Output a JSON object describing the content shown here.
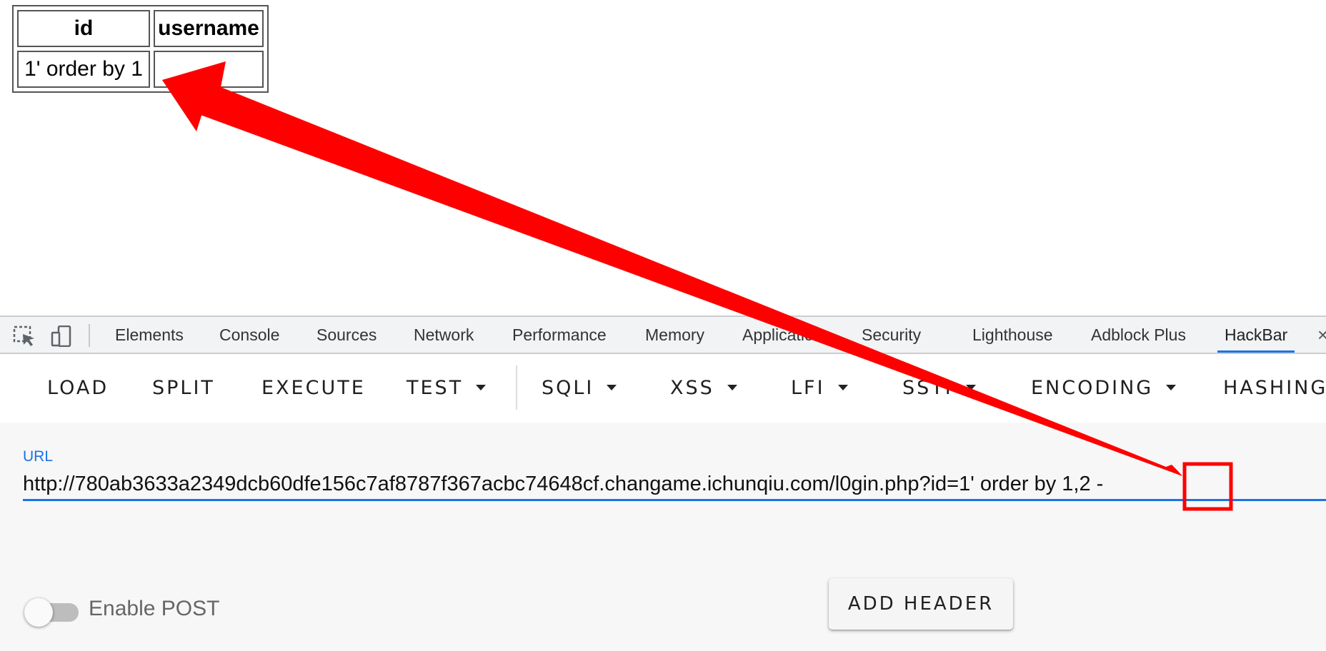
{
  "result_table": {
    "headers": [
      "id",
      "username"
    ],
    "row": {
      "id": "1' order by 1",
      "username": ""
    }
  },
  "devtools": {
    "tabs": [
      "Elements",
      "Console",
      "Sources",
      "Network",
      "Performance",
      "Memory",
      "Application",
      "Security",
      "Lighthouse",
      "Adblock Plus",
      "HackBar"
    ],
    "active_tab": "HackBar",
    "icons": [
      "inspect-element-icon",
      "device-toolbar-icon",
      "close-icon"
    ]
  },
  "hackbar": {
    "buttons": {
      "load": "LOAD",
      "split": "SPLIT",
      "execute": "EXECUTE",
      "test": "TEST",
      "sqli": "SQLI",
      "xss": "XSS",
      "lfi": "LFI",
      "ssti": "SSTI",
      "encoding": "ENCODING",
      "hashing": "HASHING"
    },
    "url_label": "URL",
    "url_value": "http://780ab3633a2349dcb60dfe156c7af8787f367acbc74648cf.changame.ichunqiu.com/l0gin.php?id=1' order by 1,2 -",
    "enable_post_label": "Enable POST",
    "enable_post": false,
    "add_header_label": "ADD HEADER"
  },
  "colors": {
    "annotation_red": "#ff0000",
    "accent_blue": "#1a73e8"
  }
}
